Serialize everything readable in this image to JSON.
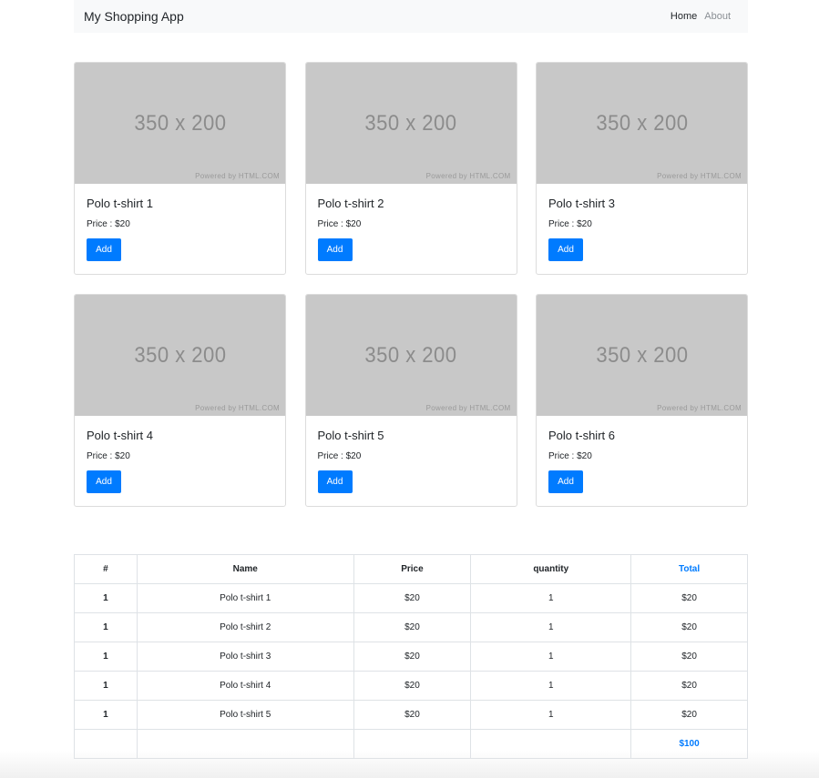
{
  "navbar": {
    "brand": "My Shopping App",
    "links": [
      {
        "label": "Home",
        "active": true
      },
      {
        "label": "About",
        "active": false
      }
    ]
  },
  "products": [
    {
      "title": "Polo t-shirt 1",
      "price": "Price : $20",
      "image_label": "350 x 200",
      "image_credit": "Powered by HTML.COM",
      "button": "Add"
    },
    {
      "title": "Polo t-shirt 2",
      "price": "Price : $20",
      "image_label": "350 x 200",
      "image_credit": "Powered by HTML.COM",
      "button": "Add"
    },
    {
      "title": "Polo t-shirt 3",
      "price": "Price : $20",
      "image_label": "350 x 200",
      "image_credit": "Powered by HTML.COM",
      "button": "Add"
    },
    {
      "title": "Polo t-shirt 4",
      "price": "Price : $20",
      "image_label": "350 x 200",
      "image_credit": "Powered by HTML.COM",
      "button": "Add"
    },
    {
      "title": "Polo t-shirt 5",
      "price": "Price : $20",
      "image_label": "350 x 200",
      "image_credit": "Powered by HTML.COM",
      "button": "Add"
    },
    {
      "title": "Polo t-shirt 6",
      "price": "Price : $20",
      "image_label": "350 x 200",
      "image_credit": "Powered by HTML.COM",
      "button": "Add"
    }
  ],
  "cart": {
    "headers": [
      "#",
      "Name",
      "Price",
      "quantity",
      "Total"
    ],
    "rows": [
      {
        "idx": "1",
        "name": "Polo t-shirt 1",
        "price": "$20",
        "qty": "1",
        "total": "$20"
      },
      {
        "idx": "1",
        "name": "Polo t-shirt 2",
        "price": "$20",
        "qty": "1",
        "total": "$20"
      },
      {
        "idx": "1",
        "name": "Polo t-shirt 3",
        "price": "$20",
        "qty": "1",
        "total": "$20"
      },
      {
        "idx": "1",
        "name": "Polo t-shirt 4",
        "price": "$20",
        "qty": "1",
        "total": "$20"
      },
      {
        "idx": "1",
        "name": "Polo t-shirt 5",
        "price": "$20",
        "qty": "1",
        "total": "$20"
      }
    ],
    "grand_total": "$100"
  },
  "colors": {
    "primary": "#007bff",
    "navbar_bg": "#f8f9fa",
    "placeholder_bg": "#c8c8c8"
  }
}
